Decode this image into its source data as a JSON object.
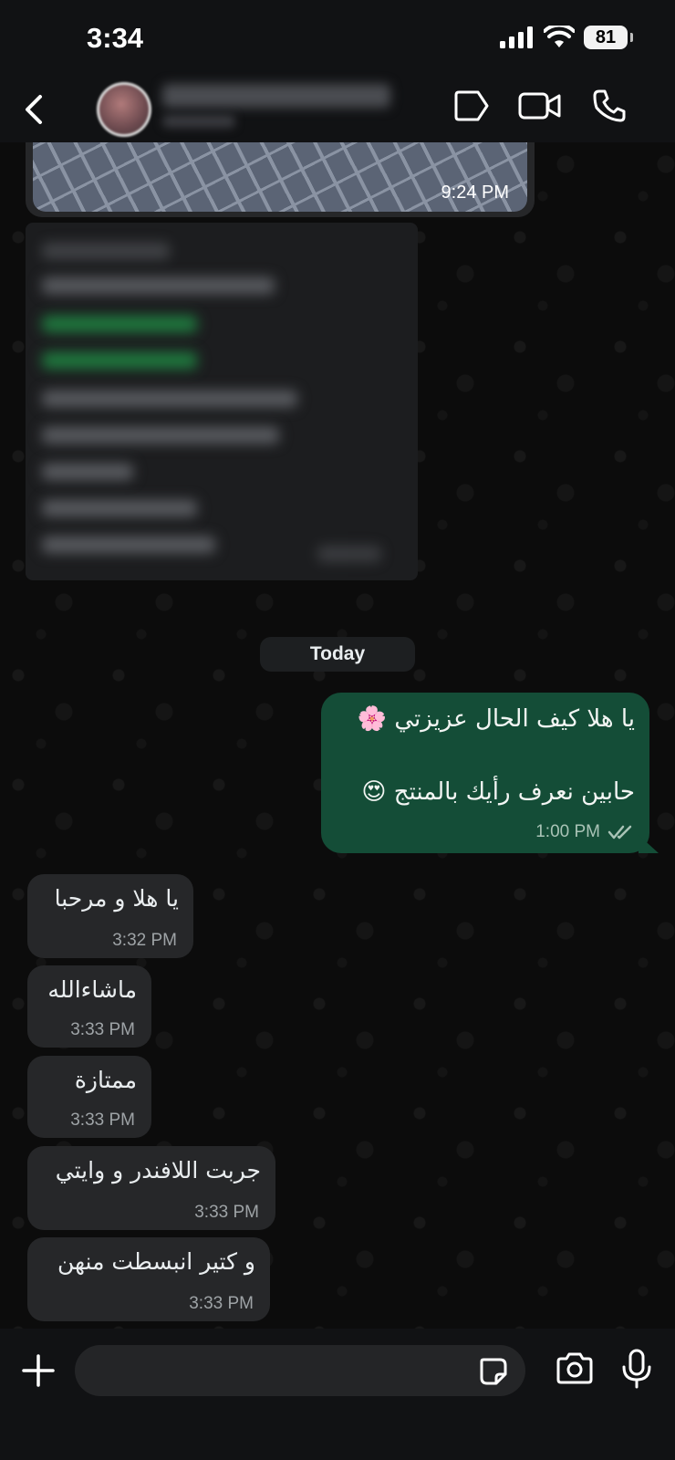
{
  "status_bar": {
    "time": "3:34",
    "battery": "81"
  },
  "header": {
    "back_icon": "chevron-left-icon",
    "contact_name": "",
    "icons": [
      "label-icon",
      "video-camera-icon",
      "phone-icon"
    ]
  },
  "chat": {
    "location_message": {
      "time": "9:24 PM"
    },
    "date_separator": "Today",
    "outgoing": {
      "line1": "يا هلا كيف الحال عزيزتي 🌸",
      "line2": "حابين نعرف رأيك بالمنتج 😍",
      "time": "1:00 PM",
      "status_icon": "double-check-icon"
    },
    "incoming": [
      {
        "text": "يا هلا و مرحبا",
        "time": "3:32 PM"
      },
      {
        "text": "ماشاءالله",
        "time": "3:33 PM"
      },
      {
        "text": "ممتازة",
        "time": "3:33 PM"
      },
      {
        "text": "جربت اللافندر و وايتي",
        "time": "3:33 PM"
      },
      {
        "text": "و كتير انبسطت منهن",
        "time": "3:33 PM"
      }
    ]
  },
  "input_bar": {
    "placeholder": "",
    "icons": [
      "plus-icon",
      "sticker-icon",
      "camera-icon",
      "microphone-icon"
    ]
  }
}
